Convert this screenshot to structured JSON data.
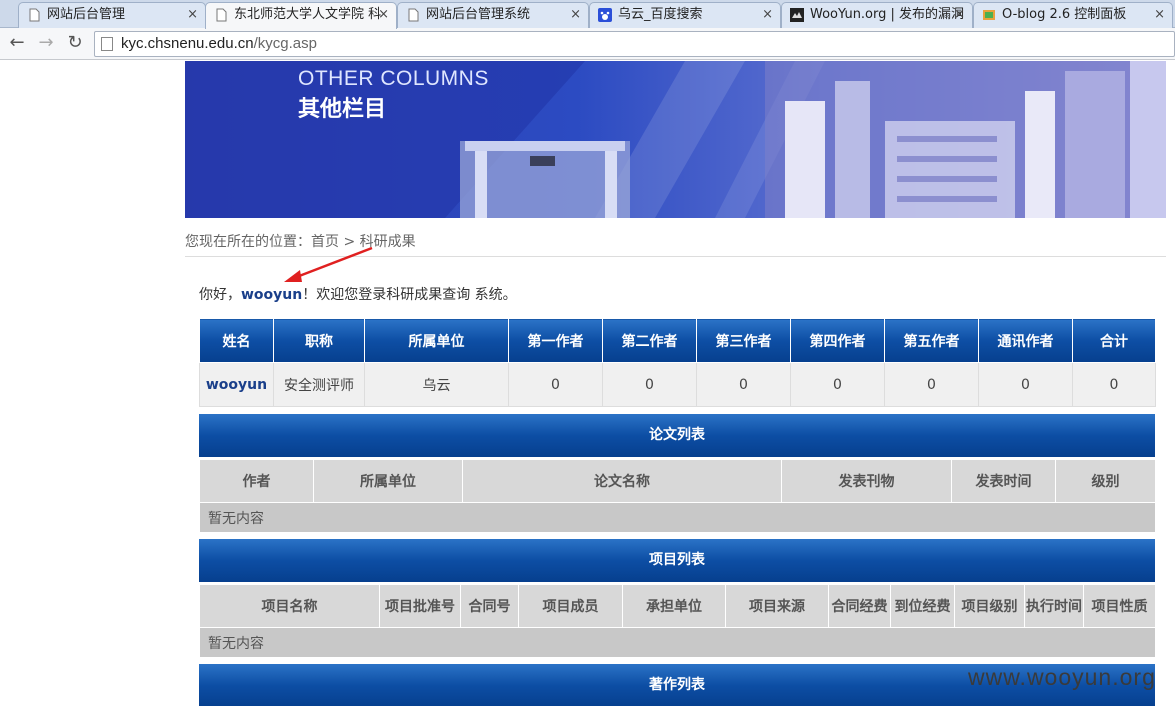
{
  "browser": {
    "tabs": [
      {
        "title": "网站后台管理",
        "icon": "page-icon",
        "active": false
      },
      {
        "title": "东北师范大学人文学院 科",
        "icon": "page-icon",
        "active": true
      },
      {
        "title": "网站后台管理系统",
        "icon": "page-icon",
        "active": false
      },
      {
        "title": "乌云_百度搜索",
        "icon": "baidu-paw-icon",
        "active": false
      },
      {
        "title": "WooYun.org | 发布的漏洞",
        "icon": "wooyun-icon",
        "active": false
      },
      {
        "title": "O-blog 2.6 控制面板",
        "icon": "oblog-icon",
        "active": false
      }
    ],
    "close_glyph": "×",
    "back_glyph": "←",
    "forward_glyph": "→",
    "reload_glyph": "↻",
    "url_host": "kyc.chsnenu.edu.cn",
    "url_path": "/kycg.asp"
  },
  "banner": {
    "title_en": "OTHER COLUMNS",
    "title_cn": "其他栏目"
  },
  "breadcrumb": {
    "text": "您现在所在的位置：首页 > 科研成果"
  },
  "greeting": {
    "prefix": "你好，",
    "username": "wooyun",
    "suffix": "！欢迎您登录科研成果查询 系统。"
  },
  "summary": {
    "headers": [
      "姓名",
      "职称",
      "所属单位",
      "第一作者",
      "第二作者",
      "第三作者",
      "第四作者",
      "第五作者",
      "通讯作者",
      "合计"
    ],
    "row": [
      "wooyun",
      "安全测评师",
      "乌云",
      "0",
      "0",
      "0",
      "0",
      "0",
      "0",
      "0"
    ]
  },
  "papers": {
    "title": "论文列表",
    "headers": [
      "作者",
      "所属单位",
      "论文名称",
      "发表刊物",
      "发表时间",
      "级别"
    ],
    "empty": "暂无内容"
  },
  "projects": {
    "title": "项目列表",
    "headers": [
      "项目名称",
      "项目批准号",
      "合同号",
      "项目成员",
      "承担单位",
      "项目来源",
      "合同经费",
      "到位经费",
      "项目级别",
      "执行时间",
      "项目性质"
    ],
    "empty": "暂无内容"
  },
  "books": {
    "title": "著作列表"
  },
  "watermark": "www.wooyun.org"
}
